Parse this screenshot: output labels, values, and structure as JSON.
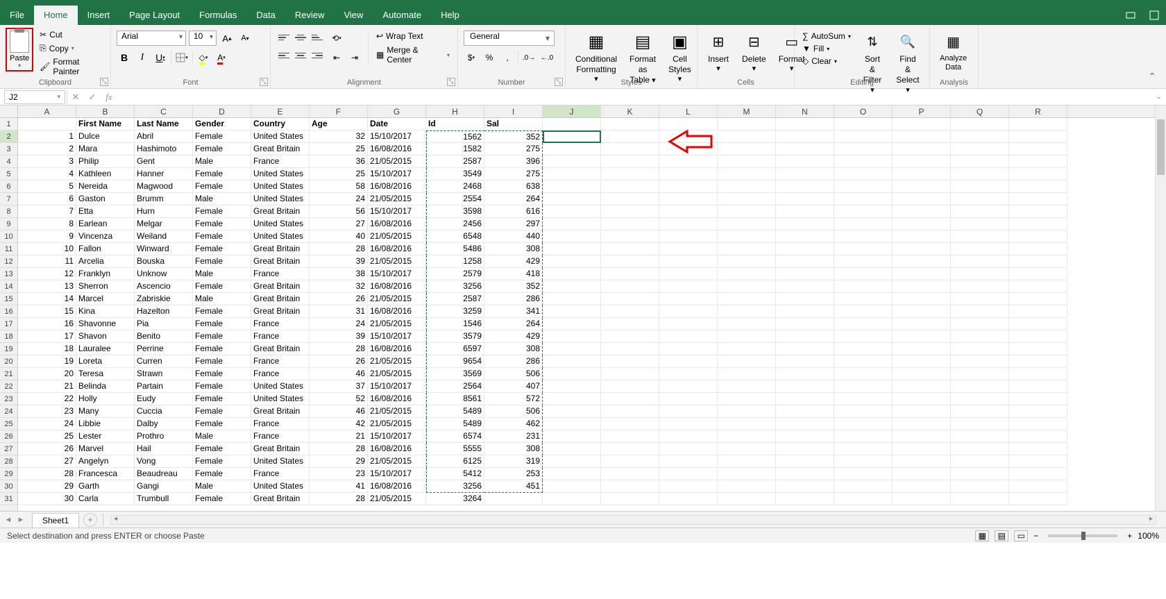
{
  "menus": [
    "File",
    "Home",
    "Insert",
    "Page Layout",
    "Formulas",
    "Data",
    "Review",
    "View",
    "Automate",
    "Help"
  ],
  "active_menu": "Home",
  "ribbon": {
    "clipboard": {
      "label": "Clipboard",
      "paste": "Paste",
      "cut": "Cut",
      "copy": "Copy",
      "fmt_painter": "Format Painter"
    },
    "font": {
      "label": "Font",
      "name": "Arial",
      "size": "10"
    },
    "alignment": {
      "label": "Alignment",
      "wrap": "Wrap Text",
      "merge": "Merge & Center"
    },
    "number": {
      "label": "Number",
      "format": "General"
    },
    "styles": {
      "label": "Styles",
      "cond": "Conditional\nFormatting",
      "table": "Format as\nTable",
      "cell": "Cell\nStyles"
    },
    "cells": {
      "label": "Cells",
      "insert": "Insert",
      "delete": "Delete",
      "format": "Format"
    },
    "editing": {
      "label": "Editing",
      "autosum": "AutoSum",
      "fill": "Fill",
      "clear": "Clear",
      "sort": "Sort &\nFilter",
      "find": "Find &\nSelect"
    },
    "analysis": {
      "label": "Analysis",
      "analyze": "Analyze\nData"
    }
  },
  "name_box": "J2",
  "formula": "",
  "columns": [
    "A",
    "B",
    "C",
    "D",
    "E",
    "F",
    "G",
    "H",
    "I",
    "J",
    "K",
    "L",
    "M",
    "N",
    "O",
    "P",
    "Q",
    "R"
  ],
  "headers": [
    "",
    "First Name",
    "Last Name",
    "Gender",
    "Country",
    "Age",
    "Date",
    "Id",
    "Sal"
  ],
  "rows": [
    [
      1,
      "Dulce",
      "Abril",
      "Female",
      "United States",
      32,
      "15/10/2017",
      1562,
      352
    ],
    [
      2,
      "Mara",
      "Hashimoto",
      "Female",
      "Great Britain",
      25,
      "16/08/2016",
      1582,
      275
    ],
    [
      3,
      "Philip",
      "Gent",
      "Male",
      "France",
      36,
      "21/05/2015",
      2587,
      396
    ],
    [
      4,
      "Kathleen",
      "Hanner",
      "Female",
      "United States",
      25,
      "15/10/2017",
      3549,
      275
    ],
    [
      5,
      "Nereida",
      "Magwood",
      "Female",
      "United States",
      58,
      "16/08/2016",
      2468,
      638
    ],
    [
      6,
      "Gaston",
      "Brumm",
      "Male",
      "United States",
      24,
      "21/05/2015",
      2554,
      264
    ],
    [
      7,
      "Etta",
      "Hurn",
      "Female",
      "Great Britain",
      56,
      "15/10/2017",
      3598,
      616
    ],
    [
      8,
      "Earlean",
      "Melgar",
      "Female",
      "United States",
      27,
      "16/08/2016",
      2456,
      297
    ],
    [
      9,
      "Vincenza",
      "Weiland",
      "Female",
      "United States",
      40,
      "21/05/2015",
      6548,
      440
    ],
    [
      10,
      "Fallon",
      "Winward",
      "Female",
      "Great Britain",
      28,
      "16/08/2016",
      5486,
      308
    ],
    [
      11,
      "Arcelia",
      "Bouska",
      "Female",
      "Great Britain",
      39,
      "21/05/2015",
      1258,
      429
    ],
    [
      12,
      "Franklyn",
      "Unknow",
      "Male",
      "France",
      38,
      "15/10/2017",
      2579,
      418
    ],
    [
      13,
      "Sherron",
      "Ascencio",
      "Female",
      "Great Britain",
      32,
      "16/08/2016",
      3256,
      352
    ],
    [
      14,
      "Marcel",
      "Zabriskie",
      "Male",
      "Great Britain",
      26,
      "21/05/2015",
      2587,
      286
    ],
    [
      15,
      "Kina",
      "Hazelton",
      "Female",
      "Great Britain",
      31,
      "16/08/2016",
      3259,
      341
    ],
    [
      16,
      "Shavonne",
      "Pia",
      "Female",
      "France",
      24,
      "21/05/2015",
      1546,
      264
    ],
    [
      17,
      "Shavon",
      "Benito",
      "Female",
      "France",
      39,
      "15/10/2017",
      3579,
      429
    ],
    [
      18,
      "Lauralee",
      "Perrine",
      "Female",
      "Great Britain",
      28,
      "16/08/2016",
      6597,
      308
    ],
    [
      19,
      "Loreta",
      "Curren",
      "Female",
      "France",
      26,
      "21/05/2015",
      9654,
      286
    ],
    [
      20,
      "Teresa",
      "Strawn",
      "Female",
      "France",
      46,
      "21/05/2015",
      3569,
      506
    ],
    [
      21,
      "Belinda",
      "Partain",
      "Female",
      "United States",
      37,
      "15/10/2017",
      2564,
      407
    ],
    [
      22,
      "Holly",
      "Eudy",
      "Female",
      "United States",
      52,
      "16/08/2016",
      8561,
      572
    ],
    [
      23,
      "Many",
      "Cuccia",
      "Female",
      "Great Britain",
      46,
      "21/05/2015",
      5489,
      506
    ],
    [
      24,
      "Libbie",
      "Dalby",
      "Female",
      "France",
      42,
      "21/05/2015",
      5489,
      462
    ],
    [
      25,
      "Lester",
      "Prothro",
      "Male",
      "France",
      21,
      "15/10/2017",
      6574,
      231
    ],
    [
      26,
      "Marvel",
      "Hail",
      "Female",
      "Great Britain",
      28,
      "16/08/2016",
      5555,
      308
    ],
    [
      27,
      "Angelyn",
      "Vong",
      "Female",
      "United States",
      29,
      "21/05/2015",
      6125,
      319
    ],
    [
      28,
      "Francesca",
      "Beaudreau",
      "Female",
      "France",
      23,
      "15/10/2017",
      5412,
      253
    ],
    [
      29,
      "Garth",
      "Gangi",
      "Male",
      "United States",
      41,
      "16/08/2016",
      3256,
      451
    ],
    [
      30,
      "Carla",
      "Trumbull",
      "Female",
      "Great Britain",
      28,
      "21/05/2015",
      3264,
      ""
    ]
  ],
  "marching_cols": [
    7,
    8
  ],
  "marching_rows_end": 29,
  "active_cell": {
    "row": 2,
    "col": "J"
  },
  "sheet_tab": "Sheet1",
  "status": "Select destination and press ENTER or choose Paste",
  "zoom": "100%"
}
